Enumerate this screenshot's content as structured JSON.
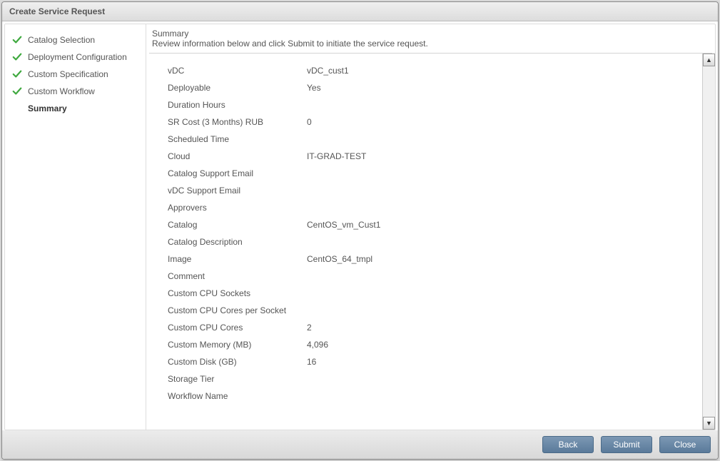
{
  "header": {
    "title": "Create Service Request"
  },
  "sidebar": {
    "steps": [
      {
        "label": "Catalog Selection",
        "done": true,
        "current": false
      },
      {
        "label": "Deployment Configuration",
        "done": true,
        "current": false
      },
      {
        "label": "Custom Specification",
        "done": true,
        "current": false
      },
      {
        "label": "Custom Workflow",
        "done": true,
        "current": false
      },
      {
        "label": "Summary",
        "done": false,
        "current": true
      }
    ]
  },
  "content": {
    "title": "Summary",
    "subtitle": "Review information below and click Submit to initiate the service request.",
    "rows": [
      {
        "label": "vDC",
        "value": "vDC_cust1"
      },
      {
        "label": "Deployable",
        "value": "Yes"
      },
      {
        "label": "Duration Hours",
        "value": ""
      },
      {
        "label": "SR Cost  (3 Months) RUB",
        "value": "0"
      },
      {
        "label": "Scheduled Time",
        "value": ""
      },
      {
        "label": "Cloud",
        "value": "IT-GRAD-TEST"
      },
      {
        "label": "Catalog Support Email",
        "value": ""
      },
      {
        "label": "vDC Support Email",
        "value": ""
      },
      {
        "label": "Approvers",
        "value": ""
      },
      {
        "label": "Catalog",
        "value": "CentOS_vm_Cust1"
      },
      {
        "label": "Catalog Description",
        "value": ""
      },
      {
        "label": "Image",
        "value": "CentOS_64_tmpl"
      },
      {
        "label": "Comment",
        "value": ""
      },
      {
        "label": "Custom CPU Sockets",
        "value": ""
      },
      {
        "label": "Custom CPU Cores per Socket",
        "value": ""
      },
      {
        "label": "Custom CPU Cores",
        "value": "2"
      },
      {
        "label": "Custom Memory (MB)",
        "value": "4,096"
      },
      {
        "label": "Custom Disk (GB)",
        "value": "16"
      },
      {
        "label": "Storage Tier",
        "value": ""
      },
      {
        "label": "Workflow Name",
        "value": ""
      }
    ]
  },
  "footer": {
    "back": "Back",
    "submit": "Submit",
    "close": "Close"
  }
}
